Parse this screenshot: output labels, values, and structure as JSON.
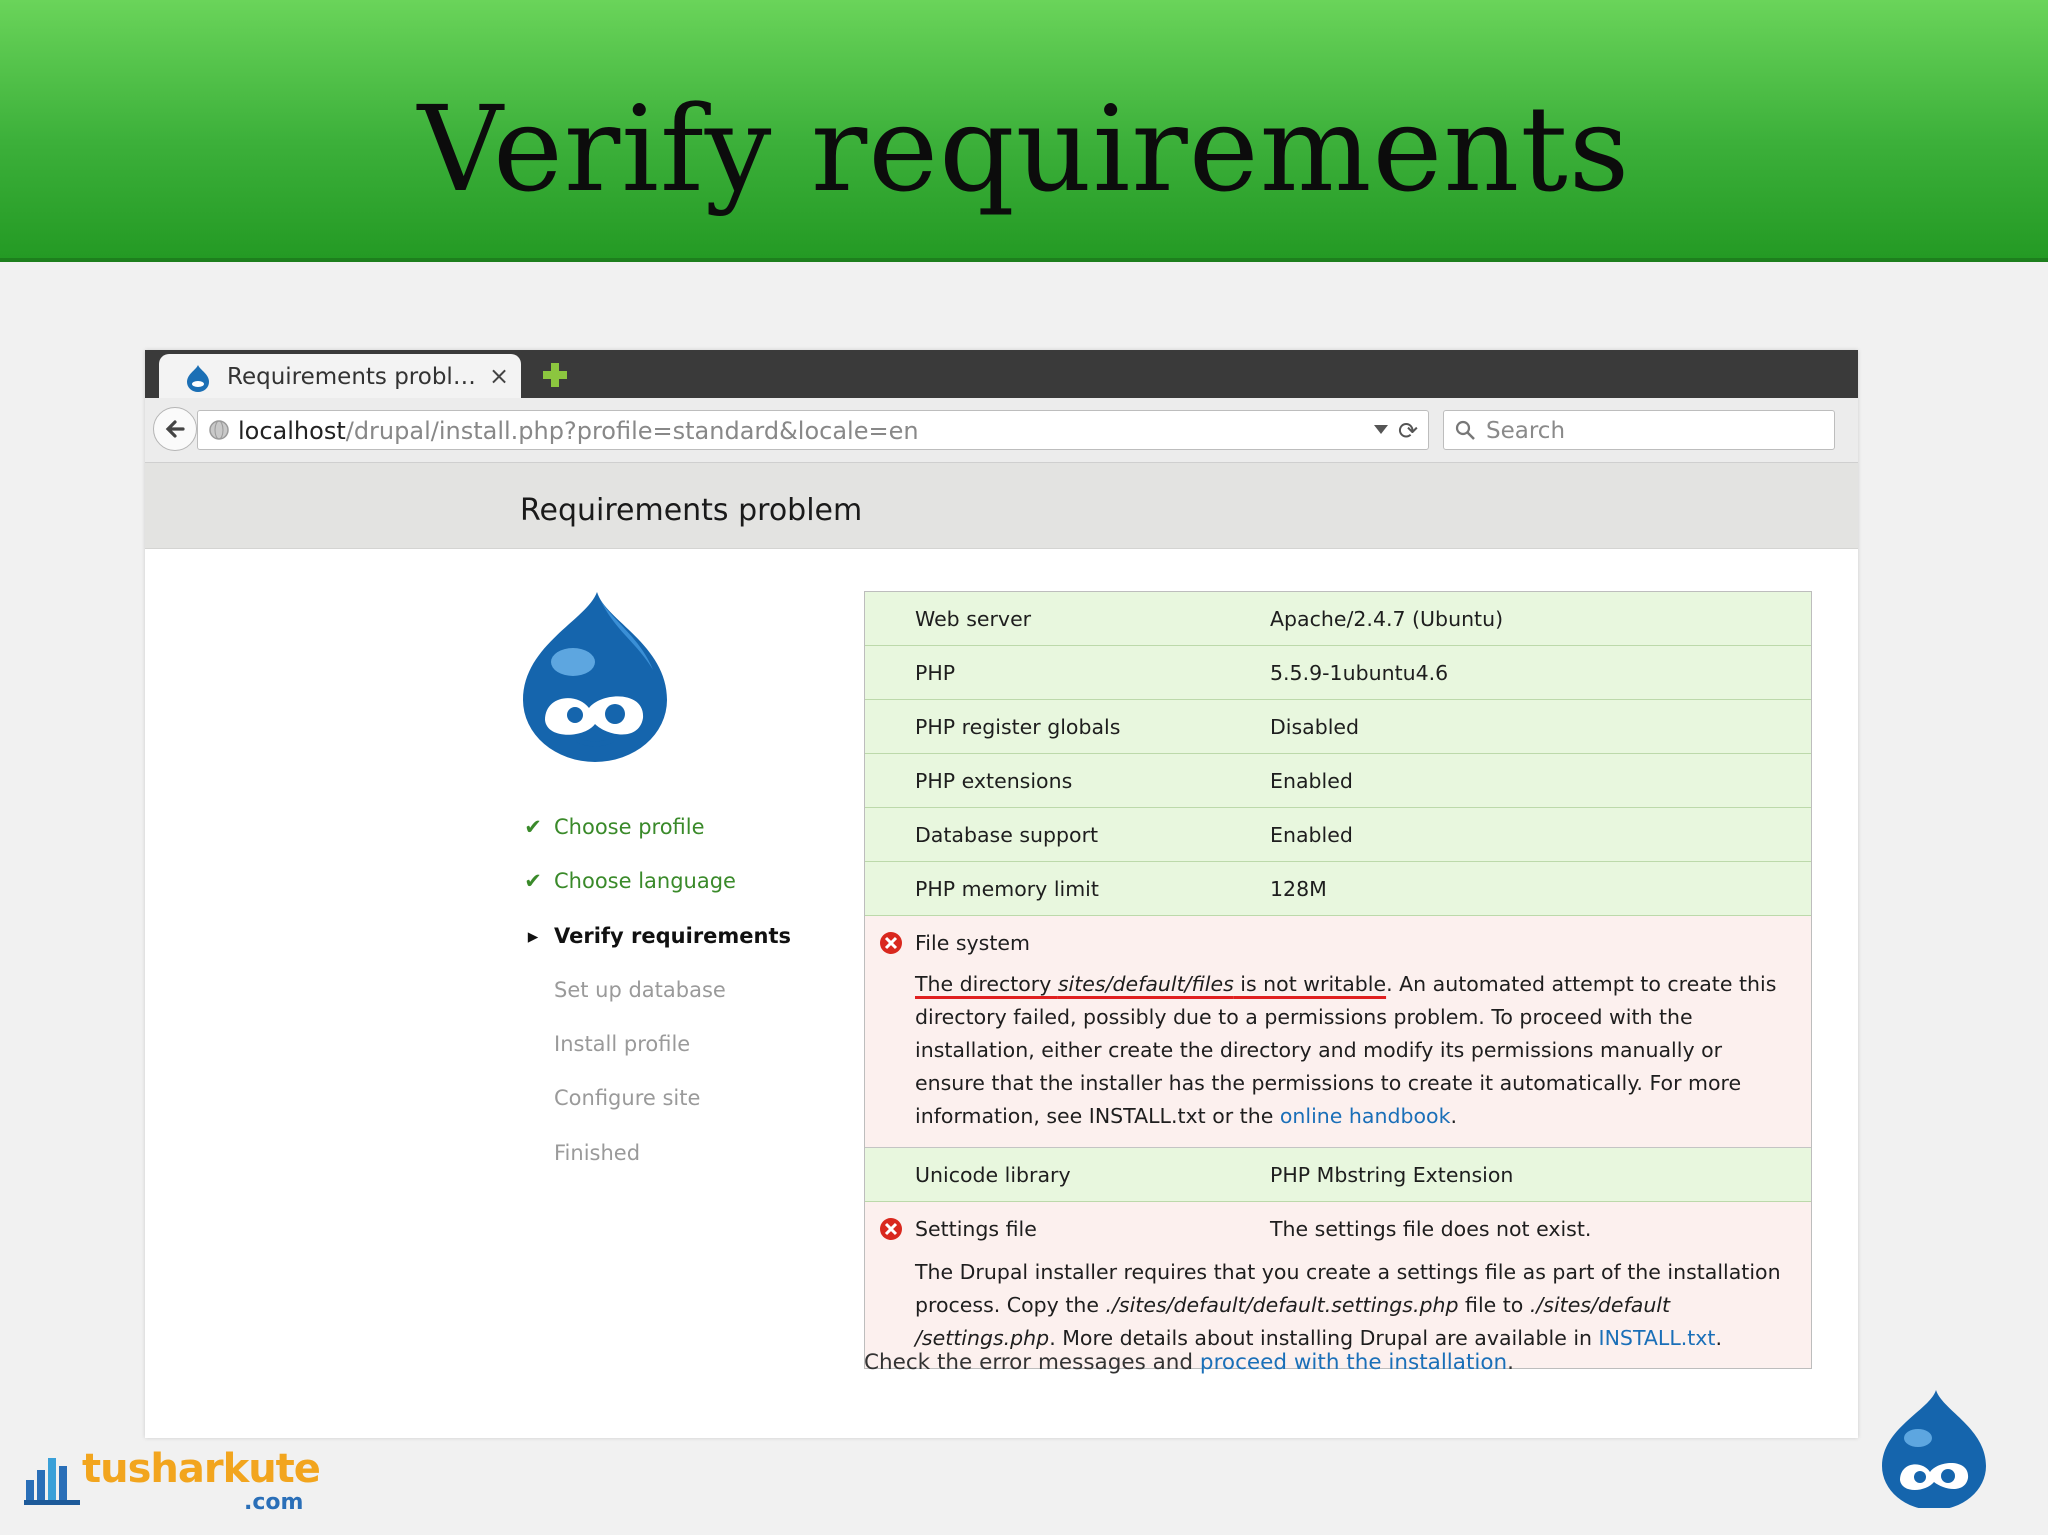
{
  "slide": {
    "title": "Verify requirements",
    "brand": {
      "name": "tusharkute",
      "domain": ".com"
    }
  },
  "browser": {
    "tab": {
      "title": "Requirements probl…",
      "favicon": "drupal-drop-icon",
      "close": "×"
    },
    "url": {
      "host": "localhost",
      "path": "/drupal/install.php?profile=standard&locale=en"
    },
    "search": {
      "placeholder": "Search"
    }
  },
  "page": {
    "title": "Requirements problem",
    "steps": [
      {
        "label": "Choose profile",
        "state": "done"
      },
      {
        "label": "Choose language",
        "state": "done"
      },
      {
        "label": "Verify requirements",
        "state": "active"
      },
      {
        "label": "Set up database",
        "state": "pending"
      },
      {
        "label": "Install profile",
        "state": "pending"
      },
      {
        "label": "Configure site",
        "state": "pending"
      },
      {
        "label": "Finished",
        "state": "pending"
      }
    ],
    "requirements": {
      "web_server": {
        "title": "Web server",
        "value": "Apache/2.4.7 (Ubuntu)"
      },
      "php": {
        "title": "PHP",
        "value": "5.5.9-1ubuntu4.6"
      },
      "register_globals": {
        "title": "PHP register globals",
        "value": "Disabled"
      },
      "extensions": {
        "title": "PHP extensions",
        "value": "Enabled"
      },
      "database": {
        "title": "Database support",
        "value": "Enabled"
      },
      "memory": {
        "title": "PHP memory limit",
        "value": "128M"
      },
      "file_system": {
        "title": "File system",
        "desc_pre": "The directory ",
        "desc_path": "sites/default/files",
        "desc_not_writable": " is not writable",
        "desc_mid": ". An automated attempt to create this directory failed, possibly due to a permissions problem. To proceed with the installation, either create the directory and modify its permissions manually or ensure that the installer has the permissions to create it automatically. For more information, see INSTALL.txt or the ",
        "desc_link": "online handbook",
        "desc_end": "."
      },
      "unicode": {
        "title": "Unicode library",
        "value": "PHP Mbstring Extension"
      },
      "settings": {
        "title": "Settings file",
        "value": "The settings file does not exist.",
        "desc_pre": "The Drupal installer requires that you create a settings file as part of the installation process. Copy the ",
        "desc_src": "./sites/default/default.settings.php",
        "desc_mid": " file to ",
        "desc_dst": "./sites/default /settings.php",
        "desc_post": ". More details about installing Drupal are available in ",
        "desc_link": "INSTALL.txt",
        "desc_end": "."
      }
    },
    "footer": {
      "pre": "Check the error messages and ",
      "link": "proceed with the installation",
      "end": "."
    }
  },
  "colors": {
    "banner": "#3cb03a",
    "ok_row": "#e8f7de",
    "error_row": "#fcf0ee",
    "link": "#1a6fb8",
    "done_step": "#3a8a2a"
  }
}
